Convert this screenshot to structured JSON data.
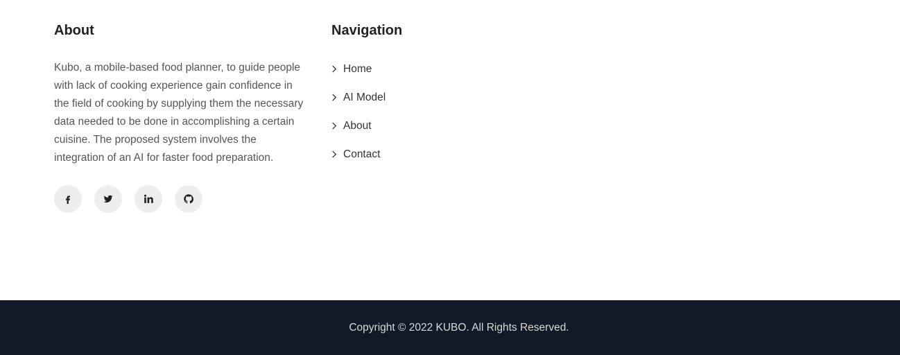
{
  "about": {
    "title": "About",
    "text": "Kubo, a mobile-based food planner, to guide people with lack of cooking experience gain confidence in the field of cooking by supplying them the necessary data needed to be done in accomplishing a certain cuisine. The proposed system involves the integration of an AI for faster food preparation.",
    "social": [
      {
        "icon": "facebook-icon"
      },
      {
        "icon": "twitter-icon"
      },
      {
        "icon": "linkedin-icon"
      },
      {
        "icon": "github-icon"
      }
    ]
  },
  "navigation": {
    "title": "Navigation",
    "items": [
      {
        "label": "Home"
      },
      {
        "label": "AI Model"
      },
      {
        "label": "About"
      },
      {
        "label": "Contact"
      }
    ]
  },
  "footer": {
    "copyright": "Copyright © 2022 KUBO. All Rights Reserved."
  },
  "colors": {
    "footer_background": "#111a26",
    "social_background": "#eeeeee"
  }
}
